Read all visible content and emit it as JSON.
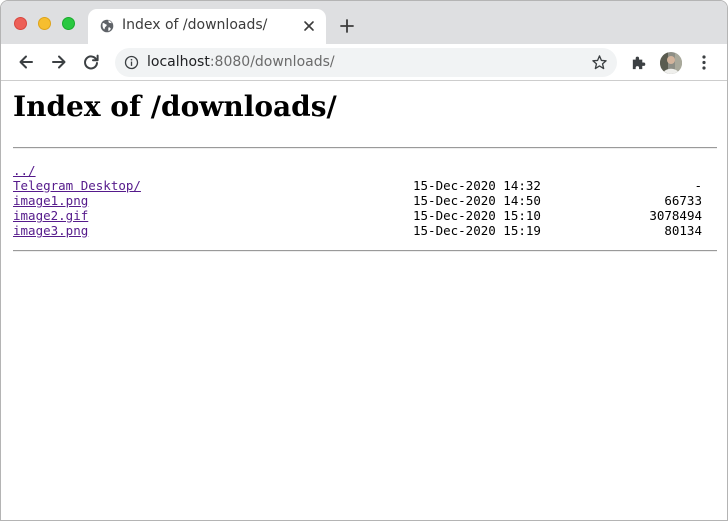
{
  "browser": {
    "tab": {
      "title": "Index of /downloads/"
    },
    "address": {
      "host": "localhost",
      "rest": ":8080/downloads/"
    },
    "icons": {
      "favicon": "globe-icon",
      "tab_close": "close-icon",
      "new_tab": "plus-icon",
      "back": "arrow-left-icon",
      "forward": "arrow-right-icon",
      "reload": "reload-icon",
      "site_info": "info-icon",
      "bookmark": "star-icon",
      "extensions": "puzzle-icon",
      "profile": "avatar",
      "menu": "kebab-menu-icon"
    },
    "colors": {
      "tabstrip": "#dedfe1",
      "omnibox": "#f1f3f4",
      "close": "#ed5f57",
      "minimize": "#f6be2f",
      "maximize": "#29c840",
      "visited_link": "#551a8b"
    }
  },
  "page": {
    "title": "Index of /downloads/",
    "entries": [
      {
        "name": "../",
        "date": "",
        "size": ""
      },
      {
        "name": "Telegram Desktop/",
        "date": "15-Dec-2020 14:32",
        "size": "-"
      },
      {
        "name": "image1.png",
        "date": "15-Dec-2020 14:50",
        "size": "66733"
      },
      {
        "name": "image2.gif",
        "date": "15-Dec-2020 15:10",
        "size": "3078494"
      },
      {
        "name": "image3.png",
        "date": "15-Dec-2020 15:19",
        "size": "80134"
      }
    ]
  }
}
